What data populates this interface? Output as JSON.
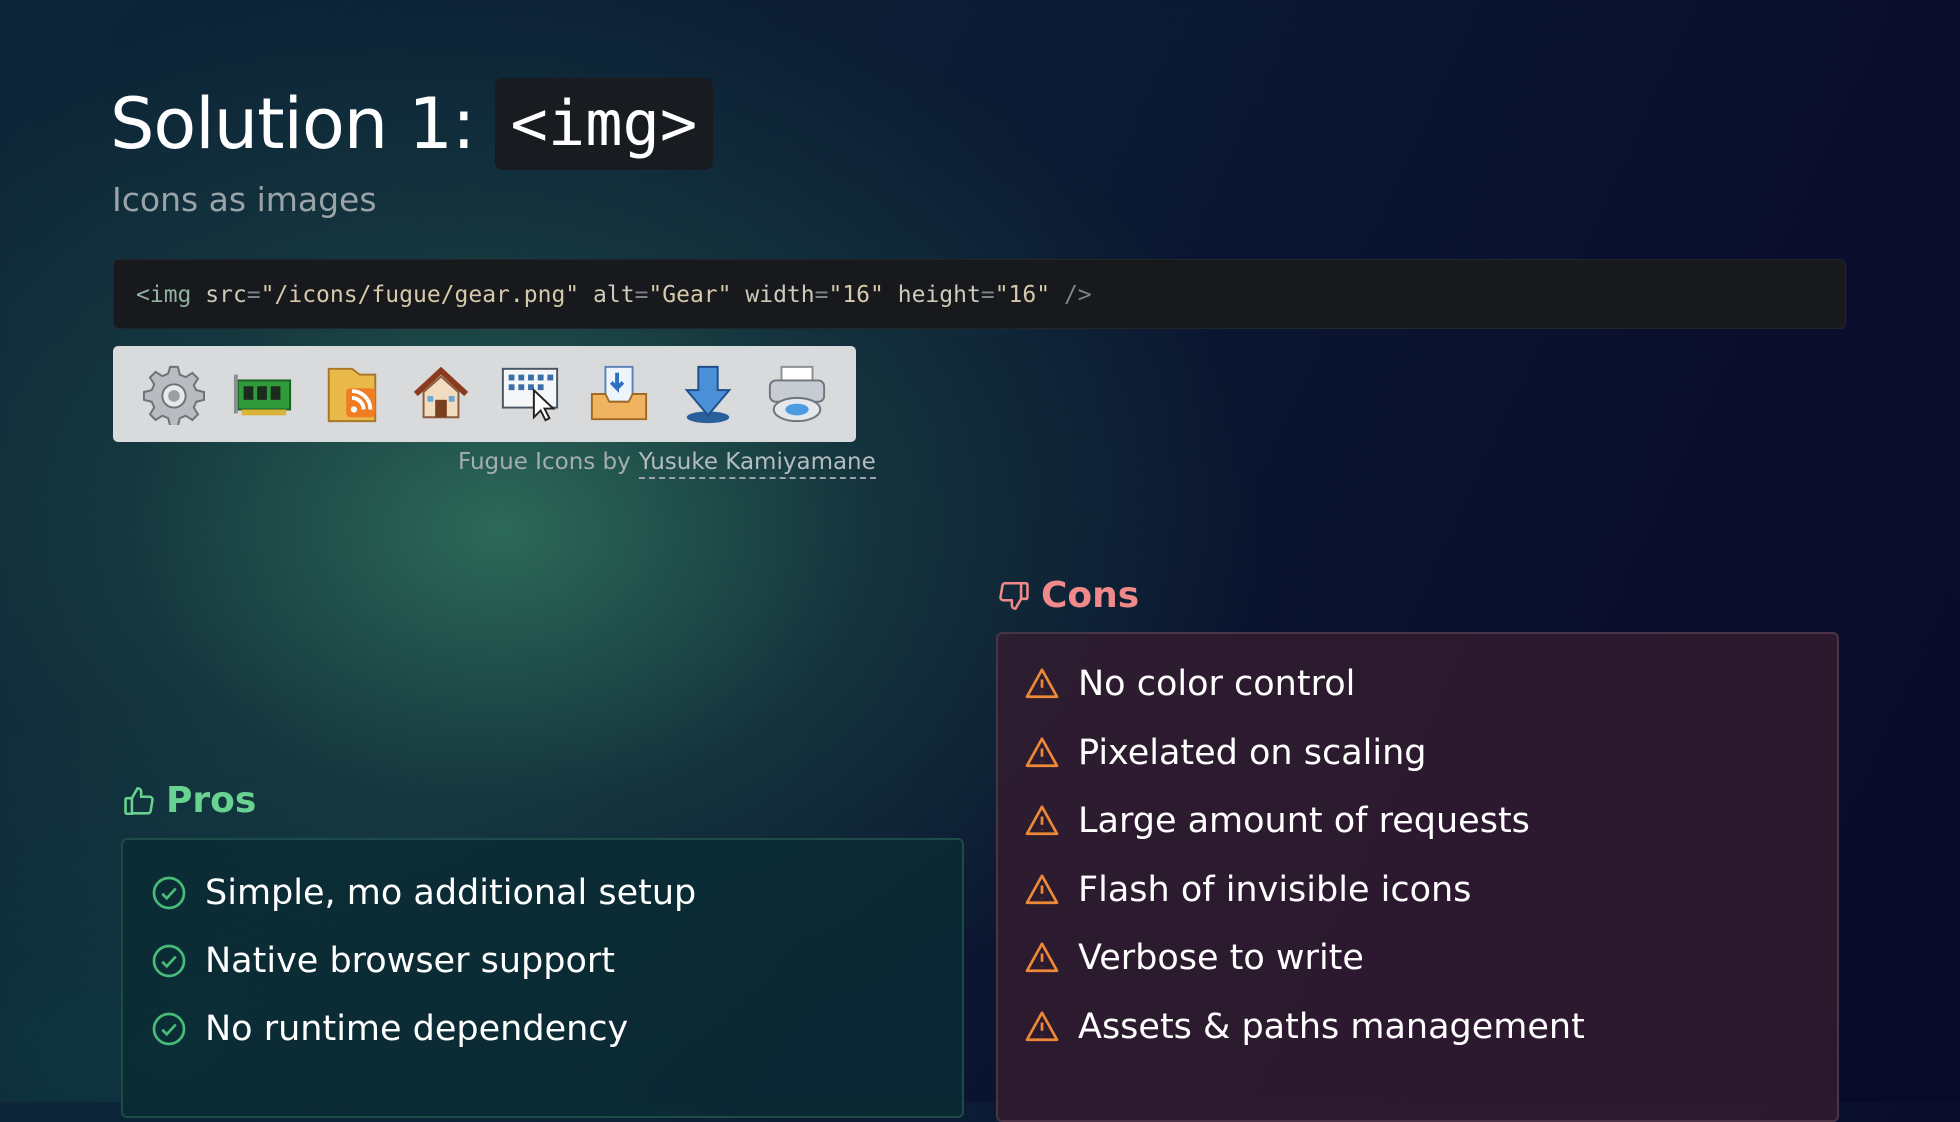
{
  "slide": {
    "title_text": "Solution 1:",
    "title_code": "<img>",
    "subtitle": "Icons as images"
  },
  "code_sample": {
    "open": "<img",
    "src_attr": "src",
    "src_val": "\"/icons/fugue/gear.png\"",
    "alt_attr": "alt",
    "alt_val": "\"Gear\"",
    "width_attr": "width",
    "width_val": "\"16\"",
    "height_attr": "height",
    "height_val": "\"16\"",
    "eq": "=",
    "close": "/>"
  },
  "icon_strip": {
    "icons": [
      "gear-icon",
      "memory-card-icon",
      "rss-folder-icon",
      "home-icon",
      "screen-cursor-icon",
      "inbox-document-icon",
      "download-arrow-icon",
      "printer-icon"
    ]
  },
  "credit": {
    "prefix": "Fugue Icons by",
    "author": "Yusuke Kamiyamane"
  },
  "pros": {
    "heading": "Pros",
    "color": "#68d391",
    "items": [
      "Simple, mo additional setup",
      "Native browser support",
      "No runtime dependency"
    ]
  },
  "cons": {
    "heading": "Cons",
    "color": "#f08a8a",
    "warning_color": "#ed8936",
    "items": [
      "No color control",
      "Pixelated on scaling",
      "Large amount of requests",
      "Flash of invisible icons",
      "Verbose to write",
      "Assets & paths management"
    ]
  }
}
